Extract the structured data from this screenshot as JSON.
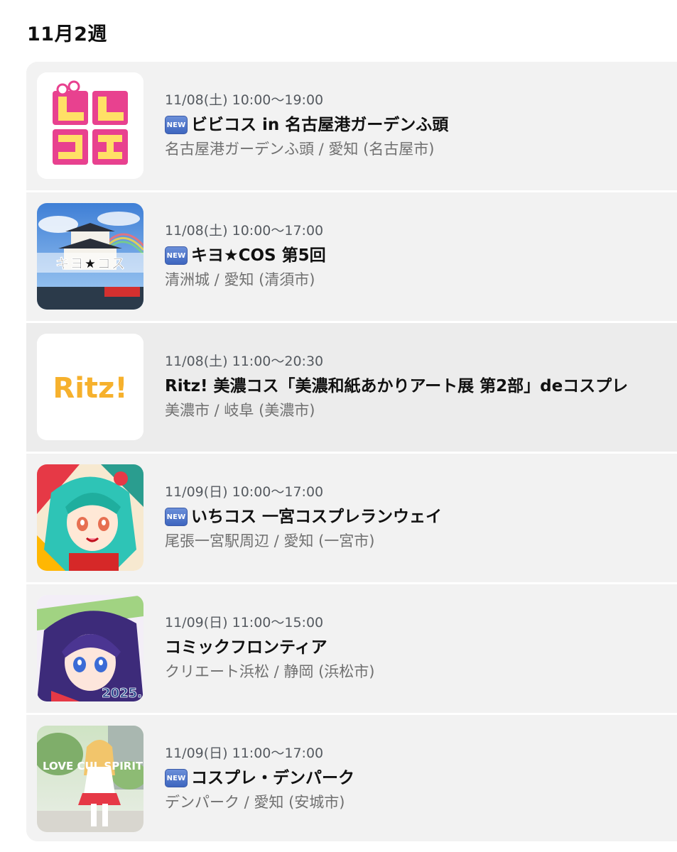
{
  "section": {
    "title": "11月2週"
  },
  "colors": {
    "row_bg": "#f2f2f2",
    "highlight_bg": "#ececec",
    "new_badge": "#4a72c8"
  },
  "events": [
    {
      "date": "11/08(土) 10:00〜19:00",
      "is_new": true,
      "new_label": "NEW",
      "title": "ビビコス in 名古屋港ガーデンふ頭",
      "venue": "名古屋港ガーデンふ頭 / 愛知 (名古屋市)",
      "thumbnail": "bibicos-logo"
    },
    {
      "date": "11/08(土) 10:00〜17:00",
      "is_new": true,
      "new_label": "NEW",
      "title": "キヨ★COS 第5回",
      "venue": "清洲城 / 愛知 (清須市)",
      "thumbnail": "kiyocos-castle",
      "thumbnail_text": "キヨ★コス"
    },
    {
      "date": "11/08(土) 11:00〜20:30",
      "is_new": false,
      "new_label": "",
      "title": "Ritz! 美濃コス「美濃和紙あかりアート展 第2部」deコスプレ",
      "venue": "美濃市 / 岐阜 (美濃市)",
      "thumbnail": "ritz-logo",
      "thumbnail_text": "Ritz!"
    },
    {
      "date": "11/09(日) 10:00〜17:00",
      "is_new": true,
      "new_label": "NEW",
      "title": "いちコス 一宮コスプレランウェイ",
      "venue": "尾張一宮駅周辺 / 愛知 (一宮市)",
      "thumbnail": "anime-girl-green"
    },
    {
      "date": "11/09(日) 11:00〜15:00",
      "is_new": false,
      "new_label": "",
      "title": "コミックフロンティア",
      "venue": "クリエート浜松 / 静岡 (浜松市)",
      "thumbnail": "anime-girl-purple",
      "thumbnail_text": "2025."
    },
    {
      "date": "11/09(日) 11:00〜17:00",
      "is_new": true,
      "new_label": "NEW",
      "title": "コスプレ・デンパーク",
      "venue": "デンパーク / 愛知 (安城市)",
      "thumbnail": "cosplay-photo",
      "thumbnail_text": "LOVE CUL SPIRIT"
    }
  ]
}
